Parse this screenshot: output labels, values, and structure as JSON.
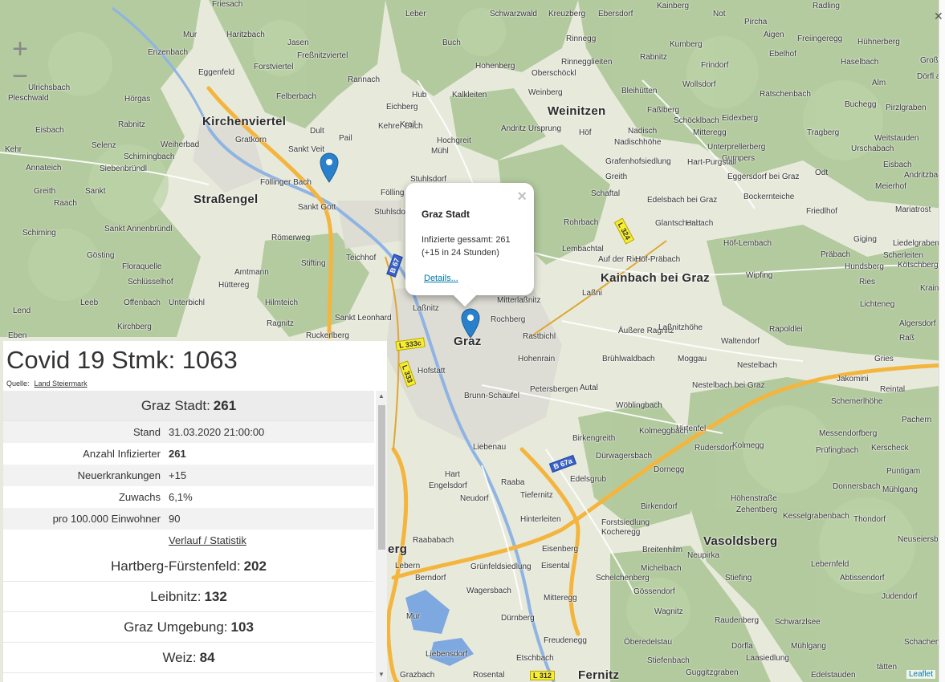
{
  "map": {
    "zoom_in": "+",
    "zoom_out": "−",
    "attribution": "Leaflet",
    "places_big": [
      "Kirchenviertel",
      "Straßengel",
      "Weinitzen",
      "Kainbach bei Graz",
      "Graz",
      "Vasoldsberg",
      "Fernitz",
      "erg"
    ],
    "places": [
      "Friesach",
      "Leber",
      "Schwarzwald",
      "Kreuzberg",
      "Ebersdorf",
      "Kainberg",
      "Not",
      "Pircha",
      "Radling",
      "Mur",
      "Haritzbach",
      "Rinnegg",
      "Kumberg",
      "Aigen",
      "Freiingeregg",
      "Hühnerberg",
      "Enzenbach",
      "Jasen",
      "Buch",
      "Rinnegglieiten",
      "Rabnitz",
      "Ebelhof",
      "Haselbach",
      "Großbach",
      "Eggenfeld",
      "Freßnitzviertel",
      "Hohenberg",
      "Frindorf",
      "Dörfl an der",
      "Forstviertel",
      "Oberschöckl",
      "Ulrichsbach",
      "Rannach",
      "Bleihütten",
      "Wollsdorf",
      "Alm",
      "Pleschwald",
      "Hub",
      "Kalkleiten",
      "Weinberg",
      "Ratschenbach",
      "Hörgas",
      "Felberbach",
      "Eichberg",
      "Faßlberg",
      "Buchegg",
      "Pirzlgraben",
      "Rabnitz",
      "Eisbach",
      "Kehrer Bach",
      "Krail",
      "Andritz Ursprung",
      "Schöcklbach",
      "Eidexberg",
      "Dult",
      "Pail",
      "Höf",
      "Nadisch",
      "Mitteregg",
      "Tragberg",
      "Weitstauden",
      "Gratkorn",
      "Hochgreit",
      "Nadischhöhe",
      "Unterprellerberg",
      "Urschabach",
      "Kehr",
      "Selenz",
      "Weiherbad",
      "Sankt Veit",
      "Mühl",
      "Schirningbach",
      "Grafenhofsiedlung",
      "Gumpers",
      "Eisbach",
      "Annateich",
      "Siebenbründl",
      "Föllinger Bach",
      "Greith",
      "Hart-Purgstall",
      "Eggersdorf bei Graz",
      "Odt",
      "Andritzbach",
      "Stuhlsdorf",
      "Meierhof",
      "Greith",
      "Sankt",
      "Fölling",
      "Schaftal",
      "Edelsbach bei Graz",
      "Bockernteiche",
      "Raach",
      "Sankt Gott",
      "Stuhlsdorfer Bach",
      "Friedlhof",
      "Mariatrost",
      "Rohrbach",
      "Glantschenbach",
      "Hart",
      "Schirning",
      "Sankt Annenbründl",
      "Römerweg",
      "Höf-Lembach",
      "Giging",
      "Liedelgraben",
      "Gösting",
      "Teichhof",
      "Lembachtal",
      "Präbach",
      "Scherleiten",
      "Floraquelle",
      "Stifting",
      "Auf der Ries",
      "Höf-Präbach",
      "Hundsberg",
      "Kötschberg",
      "Amtmann",
      "Wipfing",
      "Schlüsselhof",
      "Hüttereg",
      "Ries",
      "Laßni",
      "Krainbach",
      "Leeb",
      "Offenbach",
      "Unterbichl",
      "Hilmteich",
      "Mitterlaßnitz",
      "Lichteneg",
      "Lend",
      "Laßnitz",
      "Algersdorf",
      "Sankt Leonhard",
      "Rochberg",
      "Kirchberg",
      "Ragnitz",
      "Äußere Ragnitz",
      "Laßnitzhöhe",
      "Rapoldlei",
      "Raß",
      "Eben",
      "Ruckerlberg",
      "Rastbichl",
      "Waltendorf",
      "Hohenrain",
      "Brühlwaldbach",
      "Moggau",
      "Nestelbach",
      "Gries",
      "Hofstatt",
      "Petersbergen",
      "Autal",
      "Nestelbach bei Graz",
      "Jakomini",
      "Reintal",
      "Brunn-Schaufel",
      "Schemerlhöhe",
      "Wöblingbach",
      "Hirtenfel",
      "Pachern",
      "Kolmeggbach",
      "Liebenau",
      "Messendorfberg",
      "Birkengreith",
      "Kolmegg",
      "Prüfingbach",
      "Kerscheck",
      "Rudersdorf",
      "Hart",
      "Dürwagersbach",
      "Dornegg",
      "Puntigam",
      "Engelsdorf",
      "Raaba",
      "Edelsgrub",
      "Donnersbach",
      "Mühlgang",
      "Neudorf",
      "Tiefernitz",
      "Höhenstraße",
      "Birkendorf",
      "Zehentberg",
      "Kesselgrabenbach",
      "Thondorf",
      "Hinterleiten",
      "Forstsiedlung",
      "Kocheregg",
      "Neuseiersberg",
      "Raababach",
      "Eisenberg",
      "Breitenhilm",
      "Neupirka",
      "Lebern",
      "Grünfeldsiedlung",
      "Eisental",
      "Michelbach",
      "Lebernfeld",
      "Berndorf",
      "Schelchenberg",
      "Stiefing",
      "Abtissendorf",
      "Wagersbach",
      "Gössendorf",
      "Mitteregg",
      "Judendorf",
      "Wagnitz",
      "Dürnberg",
      "Raudenberg",
      "Schwarzlsee",
      "Mur",
      "Freudenegg",
      "Öberedelstau",
      "Schachenwald",
      "Liebensdorf",
      "Dörfla",
      "Mühlgang",
      "Etschbach",
      "Stiefenbach",
      "Laasiedlung",
      "Rosental",
      "Guggitzgraben",
      "Edelstauden",
      "tätten",
      "Grazbach"
    ],
    "road_tags": [
      "L 324",
      "B 67",
      "L 333c",
      "L 333",
      "B 67a",
      "L 312",
      "L 333",
      "B 67a"
    ]
  },
  "popup": {
    "close": "×",
    "title": "Graz Stadt",
    "line1": "Infizierte gessamt: 261",
    "line2": "(+15 in 24 Stunden)",
    "link": "Details..."
  },
  "panel": {
    "title": "Covid 19 Stmk: 1063",
    "source_label": "Quelle:",
    "source_link": "Land Steiermark",
    "selected": {
      "name": "Graz Stadt:",
      "count": "261",
      "rows": [
        {
          "k": "Stand",
          "v": "31.03.2020 21:00:00"
        },
        {
          "k": "Anzahl Infizierter",
          "v": "261"
        },
        {
          "k": "Neuerkrankungen",
          "v": "+15"
        },
        {
          "k": "Zuwachs",
          "v": "6,1%"
        },
        {
          "k": "pro 100.000 Einwohner",
          "v": "90"
        }
      ],
      "link": "Verlauf / Statistik"
    },
    "districts": [
      {
        "name": "Hartberg-Fürstenfeld:",
        "count": "202"
      },
      {
        "name": "Leibnitz:",
        "count": "132"
      },
      {
        "name": "Graz Umgebung:",
        "count": "103"
      },
      {
        "name": "Weiz:",
        "count": "84"
      }
    ]
  },
  "colors": {
    "forest": "#a9c594",
    "field": "#e7eadb",
    "river": "#8fb4e3",
    "highway": "#f4b53f",
    "marker": "#2a81cb"
  }
}
